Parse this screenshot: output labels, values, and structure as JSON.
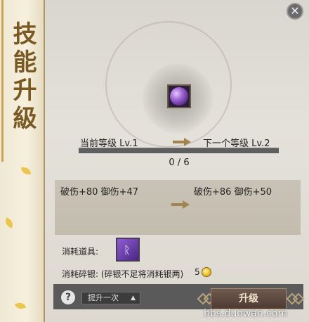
{
  "window": {
    "title": "技能升級",
    "close_glyph": "✕"
  },
  "skill": {
    "icon": "purple-orb-skill-icon"
  },
  "level": {
    "current_label": "当前等级 Lv.1",
    "next_label": "下一个等级 Lv.2",
    "progress_current": 0,
    "progress_max": 6,
    "progress_text": "0 / 6"
  },
  "stats": {
    "current": "破伤+80 御伤+47",
    "next": "破伤+86 御伤+50"
  },
  "cost": {
    "item_label": "消耗道具:",
    "item_icon": "purple-rune-item-icon",
    "silver_label": "消耗碎银: (碎银不足将消耗银两)",
    "silver_amount": "5",
    "coin_icon": "gold-coin-icon"
  },
  "footer": {
    "help_glyph": "?",
    "dropdown_value": "提升一次",
    "dropdown_caret": "▲",
    "upgrade_label": "升级"
  },
  "watermark": "bbs.duowan.com",
  "colors": {
    "accent_gold": "#d6b25a",
    "panel_bg": "#c9c2b6",
    "button_bg": "#4d3a34"
  }
}
